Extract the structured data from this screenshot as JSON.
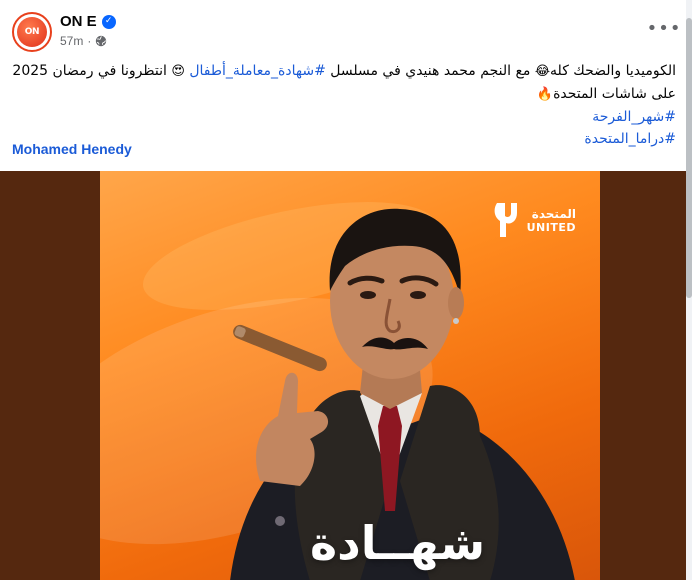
{
  "post": {
    "page_name": "ON E",
    "avatar_text": "ON",
    "timestamp": "57m",
    "privacy_icon": "globe-icon",
    "more_icon": "more-options-icon",
    "caption": {
      "segment_1": "الكوميديا والضحك كله",
      "emoji_1": "😂",
      "segment_2": " مع النجم محمد هنيدي في مسلسل ",
      "hashtag_1": "#شهادة_معاملة_أطفال",
      "emoji_2": "😍",
      "segment_3": " انتظرونا في رمضان 2025 على شاشات المتحدة",
      "emoji_3": "🔥",
      "hashtag_2": "#شهر_الفرحة",
      "hashtag_3": "#دراما_المتحدة"
    },
    "mention": "Mohamed Henedy"
  },
  "media": {
    "logo_ar": "المتحدة",
    "logo_en": "UNITED",
    "title_ar": "شهــادة"
  },
  "colors": {
    "link": "#1b5bd7",
    "verified": "#0866ff",
    "brand": "#e8401c",
    "media_bg": "#55280f"
  }
}
